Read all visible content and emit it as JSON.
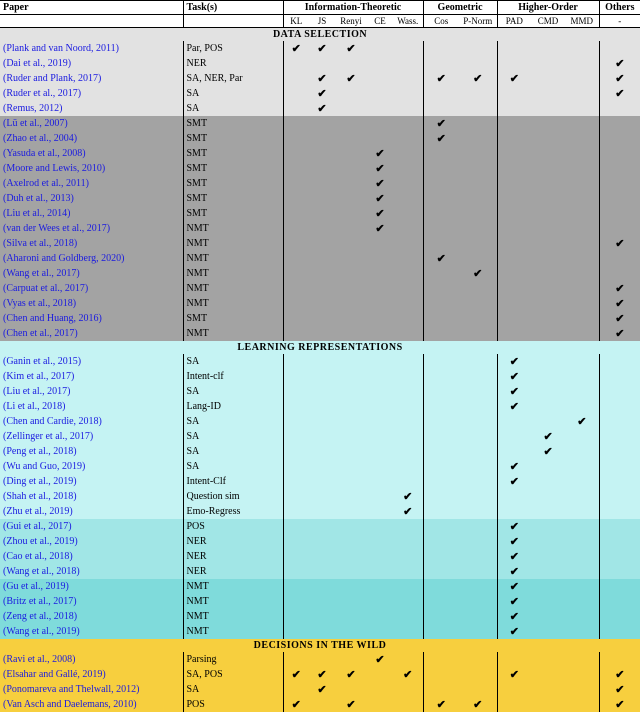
{
  "headers": {
    "paper": "Paper",
    "tasks": "Task(s)",
    "groups": {
      "info": "Information-Theoretic",
      "geo": "Geometric",
      "higher": "Higher-Order",
      "others": "Others"
    },
    "sub": {
      "kl": "KL",
      "js": "JS",
      "renyi": "Renyi",
      "ce": "CE",
      "wass": "Wass.",
      "cos": "Cos",
      "pnorm": "P-Norm",
      "pad": "PAD",
      "cmd": "CMD",
      "mmd": "MMD",
      "other": "-"
    }
  },
  "sections": [
    {
      "title": "DATA SELECTION",
      "groups": [
        {
          "bg": "#e2e2e2",
          "rows": [
            {
              "paper": "(Plank and van Noord, 2011)",
              "tasks": "Par, POS",
              "ticks": {
                "kl": 1,
                "js": 1,
                "renyi": 1
              }
            },
            {
              "paper": "(Dai et al., 2019)",
              "tasks": "NER",
              "ticks": {
                "other": 1
              }
            },
            {
              "paper": "(Ruder and Plank, 2017)",
              "tasks": "SA, NER, Par",
              "ticks": {
                "js": 1,
                "renyi": 1,
                "cos": 1,
                "pnorm": 1,
                "pad": 1,
                "other": 1
              }
            },
            {
              "paper": "(Ruder et al., 2017)",
              "tasks": "SA",
              "ticks": {
                "js": 1,
                "other": 1
              }
            },
            {
              "paper": "(Remus, 2012)",
              "tasks": "SA",
              "ticks": {
                "js": 1
              }
            }
          ]
        },
        {
          "bg": "#a3a3a3",
          "rows": [
            {
              "paper": "(Lü et al., 2007)",
              "tasks": "SMT",
              "ticks": {
                "cos": 1
              }
            },
            {
              "paper": "(Zhao et al., 2004)",
              "tasks": "SMT",
              "ticks": {
                "cos": 1
              }
            },
            {
              "paper": "(Yasuda et al., 2008)",
              "tasks": "SMT",
              "ticks": {
                "ce": 1
              }
            },
            {
              "paper": "(Moore and Lewis, 2010)",
              "tasks": "SMT",
              "ticks": {
                "ce": 1
              }
            },
            {
              "paper": "(Axelrod et al., 2011)",
              "tasks": "SMT",
              "ticks": {
                "ce": 1
              }
            },
            {
              "paper": "(Duh et al., 2013)",
              "tasks": "SMT",
              "ticks": {
                "ce": 1
              }
            },
            {
              "paper": "(Liu et al., 2014)",
              "tasks": "SMT",
              "ticks": {
                "ce": 1
              }
            },
            {
              "paper": "(van der Wees et al., 2017)",
              "tasks": "NMT",
              "ticks": {
                "ce": 1
              }
            },
            {
              "paper": "(Silva et al., 2018)",
              "tasks": "NMT",
              "ticks": {
                "other": 1
              }
            },
            {
              "paper": "(Aharoni and Goldberg, 2020)",
              "tasks": "NMT",
              "ticks": {
                "cos": 1
              }
            },
            {
              "paper": "(Wang et al., 2017)",
              "tasks": "NMT",
              "ticks": {
                "pnorm": 1
              }
            },
            {
              "paper": "(Carpuat et al., 2017)",
              "tasks": "NMT",
              "ticks": {
                "other": 1
              }
            },
            {
              "paper": "(Vyas et al., 2018)",
              "tasks": "NMT",
              "ticks": {
                "other": 1
              }
            },
            {
              "paper": "(Chen and Huang, 2016)",
              "tasks": "SMT",
              "ticks": {
                "other": 1
              }
            },
            {
              "paper": "(Chen et al., 2017)",
              "tasks": "NMT",
              "ticks": {
                "other": 1
              }
            }
          ]
        }
      ]
    },
    {
      "title": "LEARNING REPRESENTATIONS",
      "groups": [
        {
          "bg": "#c5f3f3",
          "rows": [
            {
              "paper": "(Ganin et al., 2015)",
              "tasks": "SA",
              "ticks": {
                "pad": 1
              }
            },
            {
              "paper": "(Kim et al., 2017)",
              "tasks": "Intent-clf",
              "ticks": {
                "pad": 1
              }
            },
            {
              "paper": "(Liu et al., 2017)",
              "tasks": "SA",
              "ticks": {
                "pad": 1
              }
            },
            {
              "paper": "(Li et al., 2018)",
              "tasks": "Lang-ID",
              "ticks": {
                "pad": 1
              }
            },
            {
              "paper": "(Chen and Cardie, 2018)",
              "tasks": "SA",
              "ticks": {
                "mmd": 1
              }
            },
            {
              "paper": "(Zellinger et al., 2017)",
              "tasks": "SA",
              "ticks": {
                "cmd": 1
              }
            },
            {
              "paper": "(Peng et al., 2018)",
              "tasks": "SA",
              "ticks": {
                "cmd": 1
              }
            },
            {
              "paper": "(Wu and Guo, 2019)",
              "tasks": "SA",
              "ticks": {
                "pad": 1
              }
            },
            {
              "paper": "(Ding et al., 2019)",
              "tasks": "Intent-Clf",
              "ticks": {
                "pad": 1
              }
            },
            {
              "paper": "(Shah et al., 2018)",
              "tasks": "Question sim",
              "ticks": {
                "wass": 1
              }
            },
            {
              "paper": "(Zhu et al., 2019)",
              "tasks": "Emo-Regress",
              "ticks": {
                "wass": 1
              }
            }
          ]
        },
        {
          "bg": "#a1e6e6",
          "rows": [
            {
              "paper": "(Gui et al., 2017)",
              "tasks": "POS",
              "ticks": {
                "pad": 1
              }
            },
            {
              "paper": "(Zhou et al., 2019)",
              "tasks": "NER",
              "ticks": {
                "pad": 1
              }
            },
            {
              "paper": "(Cao et al., 2018)",
              "tasks": "NER",
              "ticks": {
                "pad": 1
              }
            },
            {
              "paper": "(Wang et al., 2018)",
              "tasks": "NER",
              "ticks": {
                "pad": 1
              }
            }
          ]
        },
        {
          "bg": "#7fdbdb",
          "rows": [
            {
              "paper": "(Gu et al., 2019)",
              "tasks": "NMT",
              "ticks": {
                "pad": 1
              }
            },
            {
              "paper": "(Britz et al., 2017)",
              "tasks": "NMT",
              "ticks": {
                "pad": 1
              }
            },
            {
              "paper": "(Zeng et al., 2018)",
              "tasks": "NMT",
              "ticks": {
                "pad": 1
              }
            },
            {
              "paper": "(Wang et al., 2019)",
              "tasks": "NMT",
              "ticks": {
                "pad": 1
              }
            }
          ]
        }
      ]
    },
    {
      "title": "DECISIONS IN THE WILD",
      "groups": [
        {
          "bg": "#f7cf3e",
          "rows": [
            {
              "paper": "(Ravi et al., 2008)",
              "tasks": "Parsing",
              "ticks": {
                "ce": 1
              }
            },
            {
              "paper": "(Elsahar and Gallé, 2019)",
              "tasks": "SA, POS",
              "ticks": {
                "kl": 1,
                "js": 1,
                "renyi": 1,
                "wass": 1,
                "pad": 1,
                "other": 1
              }
            },
            {
              "paper": "(Ponomareva and Thelwall, 2012)",
              "tasks": "SA",
              "ticks": {
                "js": 1,
                "other": 1
              }
            },
            {
              "paper": "(Van Asch and Daelemans, 2010)",
              "tasks": "POS",
              "ticks": {
                "kl": 1,
                "renyi": 1,
                "cos": 1,
                "pnorm": 1,
                "other": 1
              }
            }
          ]
        }
      ]
    }
  ],
  "tick": "✔"
}
